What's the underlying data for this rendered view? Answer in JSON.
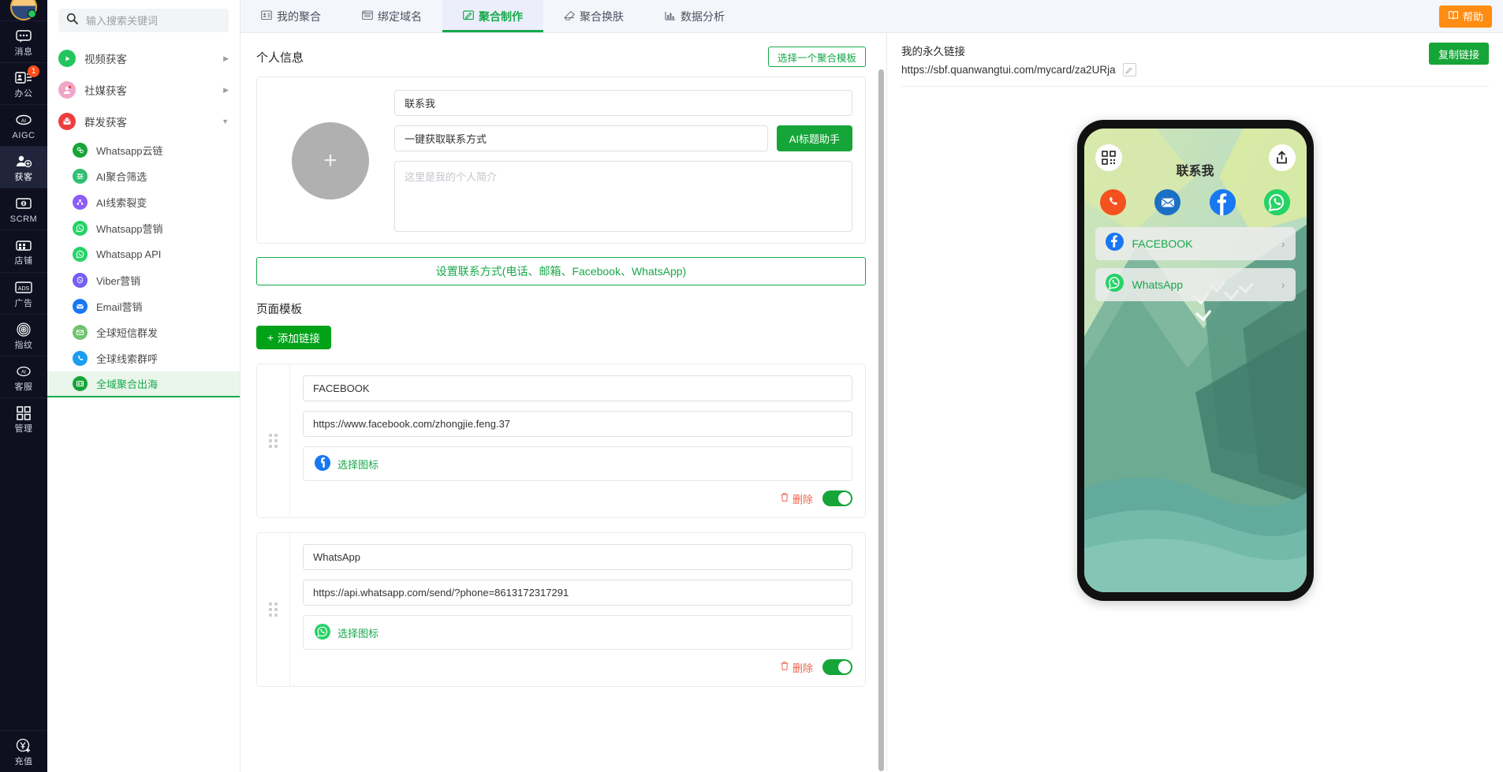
{
  "rail": {
    "avatar_name": "user-avatar",
    "items": [
      {
        "label": "消息",
        "icon": "message-icon",
        "badge": null,
        "active": false
      },
      {
        "label": "办公",
        "icon": "office-icon",
        "badge": "1",
        "active": false
      },
      {
        "label": "AIGC",
        "icon": "aigc-icon",
        "badge": null,
        "active": false
      },
      {
        "label": "获客",
        "icon": "acquire-customer-icon",
        "badge": null,
        "active": true
      },
      {
        "label": "SCRM",
        "icon": "scrm-icon",
        "badge": null,
        "active": false
      },
      {
        "label": "店铺",
        "icon": "shop-icon",
        "badge": null,
        "active": false
      },
      {
        "label": "广告",
        "icon": "ads-icon",
        "badge": null,
        "active": false
      },
      {
        "label": "指纹",
        "icon": "fingerprint-icon",
        "badge": null,
        "active": false
      },
      {
        "label": "客服",
        "icon": "customer-service-icon",
        "badge": null,
        "active": false
      },
      {
        "label": "管理",
        "icon": "management-icon",
        "badge": null,
        "active": false
      }
    ],
    "bottom": {
      "label": "充值",
      "icon": "recharge-yuan-icon"
    }
  },
  "sidebar": {
    "search": {
      "placeholder": "输入搜索关键词",
      "value": "",
      "icon": "search-icon"
    },
    "groups": [
      {
        "label": "视频获客",
        "icon": "play-icon",
        "color": "#22c55e",
        "expanded": false
      },
      {
        "label": "社媒获客",
        "icon": "social-icon",
        "color": "#f0a6c8",
        "expanded": false
      },
      {
        "label": "群发获客",
        "icon": "mass-send-icon",
        "color": "#ee3d3d",
        "expanded": true
      }
    ],
    "subitems": [
      {
        "label": "Whatsapp云链",
        "icon": "whatsapp-cloud-icon",
        "color": "#16a538",
        "active": false
      },
      {
        "label": "AI聚合筛选",
        "icon": "ai-filter-icon",
        "color": "#2fbf71",
        "active": false
      },
      {
        "label": "AI线索裂变",
        "icon": "ai-fission-icon",
        "color": "#8b5cf6",
        "active": false
      },
      {
        "label": "Whatsapp营销",
        "icon": "whatsapp-icon",
        "color": "#25d366",
        "active": false
      },
      {
        "label": "Whatsapp API",
        "icon": "whatsapp-icon",
        "color": "#25d366",
        "active": false
      },
      {
        "label": "Viber营销",
        "icon": "viber-icon",
        "color": "#7360f2",
        "active": false
      },
      {
        "label": "Email营销",
        "icon": "email-icon",
        "color": "#1877f2",
        "active": false
      },
      {
        "label": "全球短信群发",
        "icon": "sms-icon",
        "color": "#6fc36f",
        "active": false
      },
      {
        "label": "全球线索群呼",
        "icon": "phone-call-icon",
        "color": "#1b9df0",
        "active": false
      },
      {
        "label": "全域聚合出海",
        "icon": "aggregate-overseas-icon",
        "color": "#16a538",
        "active": true
      }
    ]
  },
  "topbar": {
    "tabs": [
      {
        "label": "我的聚合",
        "icon": "card-list-icon",
        "active": false
      },
      {
        "label": "绑定域名",
        "icon": "domain-icon",
        "active": false
      },
      {
        "label": "聚合制作",
        "icon": "edit-page-icon",
        "active": true
      },
      {
        "label": "聚合换肤",
        "icon": "skin-icon",
        "active": false
      },
      {
        "label": "数据分析",
        "icon": "analytics-icon",
        "active": false
      }
    ],
    "help_label": "帮助",
    "help_icon": "book-icon",
    "help_color": "#ff8c13"
  },
  "editor": {
    "section_title": "个人信息",
    "template_button": "选择一个聚合模板",
    "avatar_placeholder_icon": "plus-icon",
    "name_value": "联系我",
    "subtitle_value": "一键获取联系方式",
    "ai_button": "AI标题助手",
    "bio_placeholder": "这里是我的个人简介",
    "bio_value": "",
    "contact_button": "设置联系方式(电话、邮箱、Facebook、WhatsApp)",
    "page_template_title": "页面模板",
    "add_link_button": "添加链接",
    "links": [
      {
        "title": "FACEBOOK",
        "url": "https://www.facebook.com/zhongjie.feng.37",
        "icon_label": "选择图标",
        "icon": "facebook-icon",
        "icon_color": "#1877f2",
        "delete_label": "删除",
        "enabled": true
      },
      {
        "title": "WhatsApp",
        "url": "https://api.whatsapp.com/send/?phone=8613172317291",
        "icon_label": "选择图标",
        "icon": "whatsapp-icon",
        "icon_color": "#25d366",
        "delete_label": "删除",
        "enabled": true
      }
    ]
  },
  "preview": {
    "link_label": "我的永久链接",
    "permanent_link": "https://sbf.quanwangtui.com/mycard/za2URja",
    "edit_icon": "pencil-icon",
    "copy_button": "复制链接",
    "phone": {
      "qr_icon": "qr-code-icon",
      "share_icon": "share-icon",
      "title": "联系我",
      "quick_icons": [
        {
          "name": "phone-icon",
          "color": "#f4511e"
        },
        {
          "name": "email-icon",
          "color": "#1b6fc4"
        },
        {
          "name": "facebook-icon",
          "color": "#1877f2"
        },
        {
          "name": "whatsapp-icon",
          "color": "#25d366"
        }
      ],
      "items": [
        {
          "label": "FACEBOOK",
          "icon": "facebook-icon",
          "color": "#1877f2"
        },
        {
          "label": "WhatsApp",
          "icon": "whatsapp-icon",
          "color": "#25d366"
        }
      ]
    }
  },
  "colors": {
    "brand_green": "#16a538",
    "accent_orange": "#ff8c13",
    "danger_red": "#f0624d"
  }
}
